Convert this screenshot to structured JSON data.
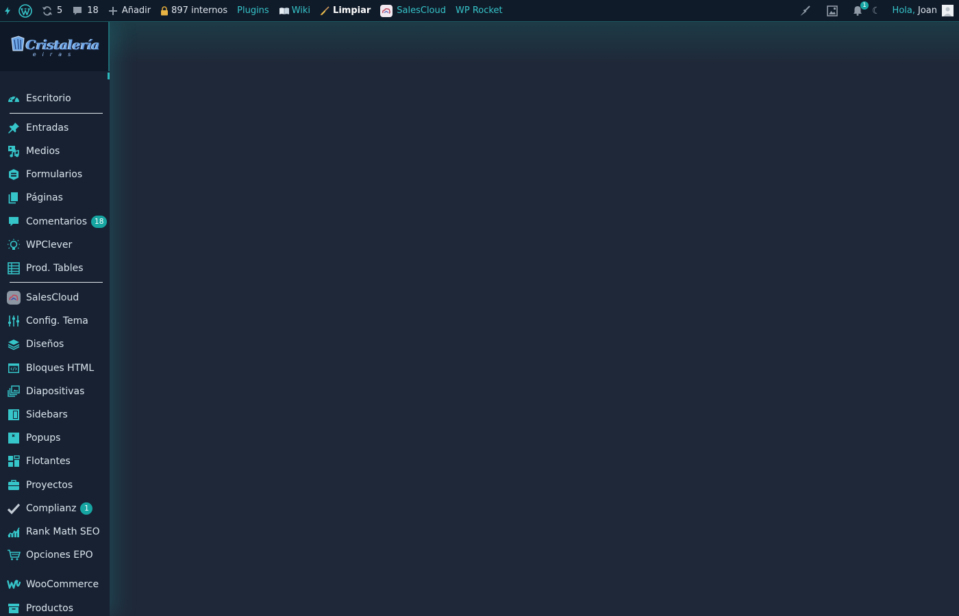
{
  "adminbar": {
    "updates_count": "5",
    "comments_count": "18",
    "add_label": "Añadir",
    "internal_label": "897 internos",
    "plugins_label": "Plugins",
    "wiki_label": "Wiki",
    "clean_label": "Limpiar",
    "salescloud_label": "SalesCloud",
    "wprocket_label": "WP Rocket",
    "notifications_count": "1",
    "greeting_prefix": "Hola,",
    "user_name": "Joan"
  },
  "logo": {
    "text": "Cristalería",
    "subtext": "eiras"
  },
  "sidebar": {
    "items": [
      {
        "label": "Escritorio",
        "icon": "dashboard-icon"
      },
      {
        "label": "Entradas",
        "icon": "pushpin-icon"
      },
      {
        "label": "Medios",
        "icon": "media-icon"
      },
      {
        "label": "Formularios",
        "icon": "forms-icon"
      },
      {
        "label": "Páginas",
        "icon": "pages-icon"
      },
      {
        "label": "Comentarios",
        "icon": "comment-icon",
        "badge": "18"
      },
      {
        "label": "WPClever",
        "icon": "lightbulb-icon"
      },
      {
        "label": "Prod. Tables",
        "icon": "table-icon"
      },
      {
        "label": "SalesCloud",
        "icon": "salescloud-icon"
      },
      {
        "label": "Config. Tema",
        "icon": "sliders-icon"
      },
      {
        "label": "Diseños",
        "icon": "layers-icon"
      },
      {
        "label": "Bloques HTML",
        "icon": "code-block-icon"
      },
      {
        "label": "Diapositivas",
        "icon": "slides-icon"
      },
      {
        "label": "Sidebars",
        "icon": "sidebar-icon"
      },
      {
        "label": "Popups",
        "icon": "popup-icon"
      },
      {
        "label": "Flotantes",
        "icon": "floating-icon"
      },
      {
        "label": "Proyectos",
        "icon": "briefcase-icon"
      },
      {
        "label": "Complianz",
        "icon": "checkmark-icon",
        "badge": "1"
      },
      {
        "label": "Rank Math SEO",
        "icon": "rankmath-icon"
      },
      {
        "label": "Opciones EPO",
        "icon": "cart-icon"
      },
      {
        "label": "WooCommerce",
        "icon": "woocommerce-icon"
      },
      {
        "label": "Productos",
        "icon": "archive-icon"
      }
    ]
  },
  "colors": {
    "accent": "#36c5c9",
    "badge": "#17a5a2",
    "background": "#1f2838",
    "sidebar": "#172132",
    "adminbar": "#101b2a"
  }
}
